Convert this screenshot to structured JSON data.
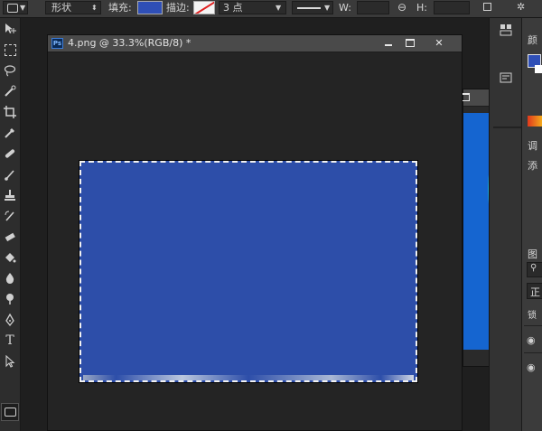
{
  "options_bar": {
    "mode_label": "形状",
    "fill_label": "填充:",
    "fill_color": "#2f4fb6",
    "stroke_label": "描边:",
    "stroke_width": "3 点",
    "w_label": "W:",
    "h_label": "H:"
  },
  "toolbar": {
    "tools": [
      "move-tool",
      "marquee-tool",
      "lasso-tool",
      "quick-selection-tool",
      "crop-tool",
      "eyedropper-tool",
      "healing-brush-tool",
      "brush-tool",
      "clone-stamp-tool",
      "history-brush-tool",
      "eraser-tool",
      "paint-bucket-tool",
      "blur-tool",
      "dodge-tool",
      "pen-tool",
      "type-tool",
      "path-selection-tool",
      "rectangle-tool"
    ]
  },
  "document": {
    "ps_badge": "Ps",
    "title": "4.png @ 33.3%(RGB/8) *",
    "canvas_color": "#2d4ea9"
  },
  "right_panel": {
    "color_tab": "颜",
    "adjust_tab": "调",
    "add_label": "添",
    "layers_tab": "图",
    "normal_label": "正",
    "lock_label": "锁"
  },
  "colors": {
    "foreground": "#2f4fb6",
    "background": "#ffffff",
    "second_doc_blue": "#1565d0",
    "accent_cyan": "#21c6d8"
  }
}
